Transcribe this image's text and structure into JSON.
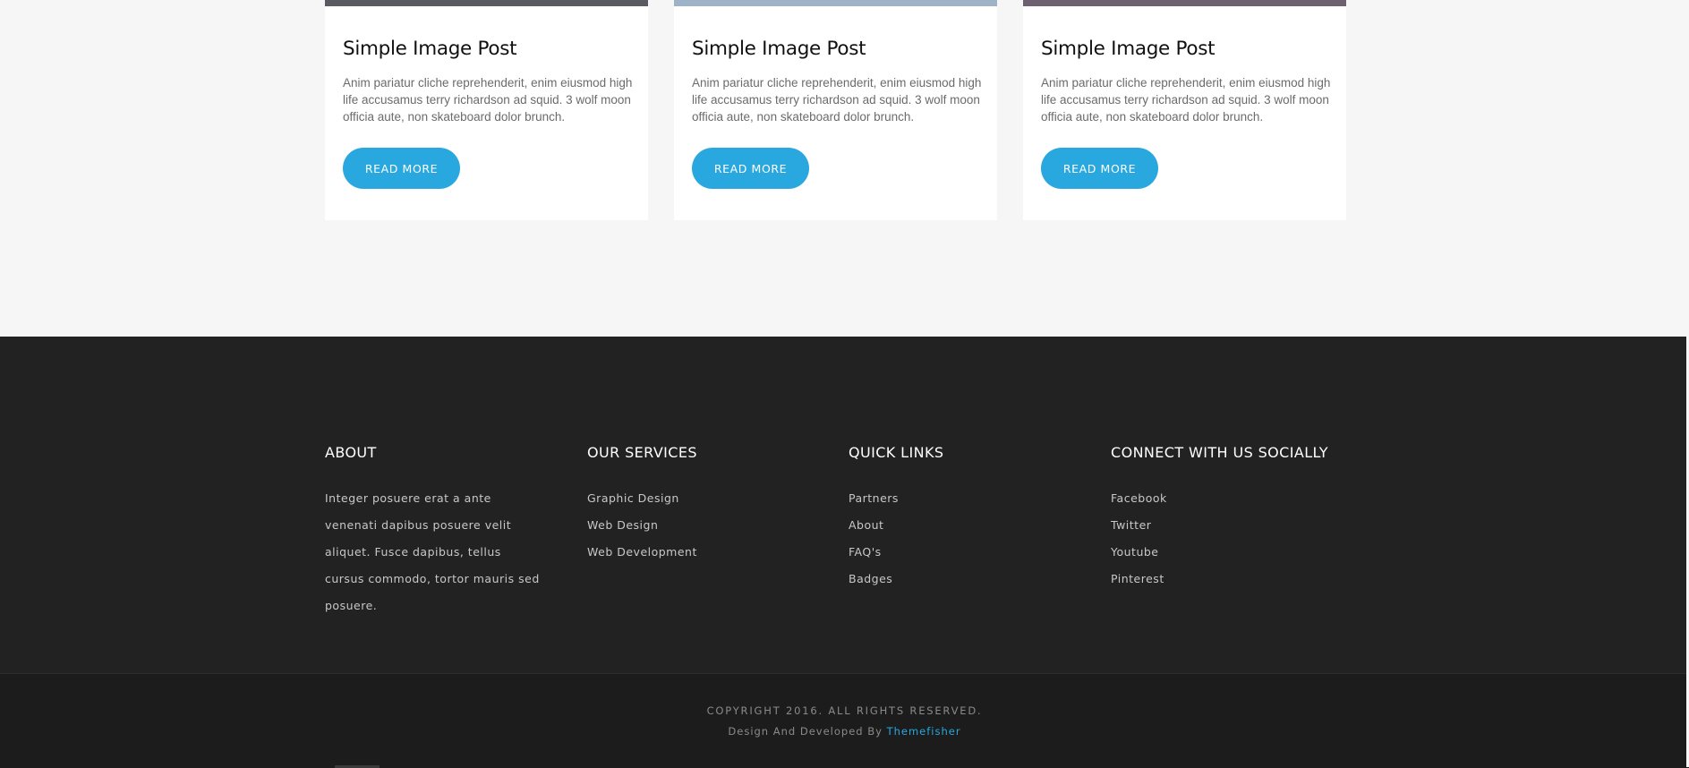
{
  "blog": {
    "cards": [
      {
        "title": "Simple Image Post",
        "description": "Anim pariatur cliche reprehenderit, enim eiusmod high life accusamus terry richardson ad squid. 3 wolf moon officia aute, non skateboard dolor brunch.",
        "button_label": "READ MORE",
        "image_strip_color": "#5a5a62"
      },
      {
        "title": "Simple Image Post",
        "description": "Anim pariatur cliche reprehenderit, enim eiusmod high life accusamus terry richardson ad squid. 3 wolf moon officia aute, non skateboard dolor brunch.",
        "button_label": "READ MORE",
        "image_strip_color": "#9fb3c8"
      },
      {
        "title": "Simple Image Post",
        "description": "Anim pariatur cliche reprehenderit, enim eiusmod high life accusamus terry richardson ad squid. 3 wolf moon officia aute, non skateboard dolor brunch.",
        "button_label": "READ MORE",
        "image_strip_color": "#6e6070"
      }
    ]
  },
  "footer": {
    "about": {
      "heading": "ABOUT",
      "text": "Integer posuere erat a ante venenati dapibus posuere velit aliquet. Fusce dapibus, tellus cursus commodo, tortor mauris sed posuere."
    },
    "services": {
      "heading": "OUR SERVICES",
      "items": [
        "Graphic Design",
        "Web Design",
        "Web Development"
      ]
    },
    "quick_links": {
      "heading": "QUICK LINKS",
      "items": [
        "Partners",
        "About",
        "FAQ's",
        "Badges"
      ]
    },
    "social": {
      "heading": "CONNECT WITH US SOCIALLY",
      "items": [
        "Facebook",
        "Twitter",
        "Youtube",
        "Pinterest"
      ]
    }
  },
  "bottom": {
    "copyright": "COPYRIGHT 2016. ALL RIGHTS RESERVED.",
    "credit_prefix": "Design And Developed By ",
    "credit_link": "Themefisher"
  },
  "colors": {
    "accent": "#29a8e0",
    "footer_bg": "#222222",
    "bottom_bg": "#1c1c1c",
    "page_bg": "#f6f6f6"
  }
}
